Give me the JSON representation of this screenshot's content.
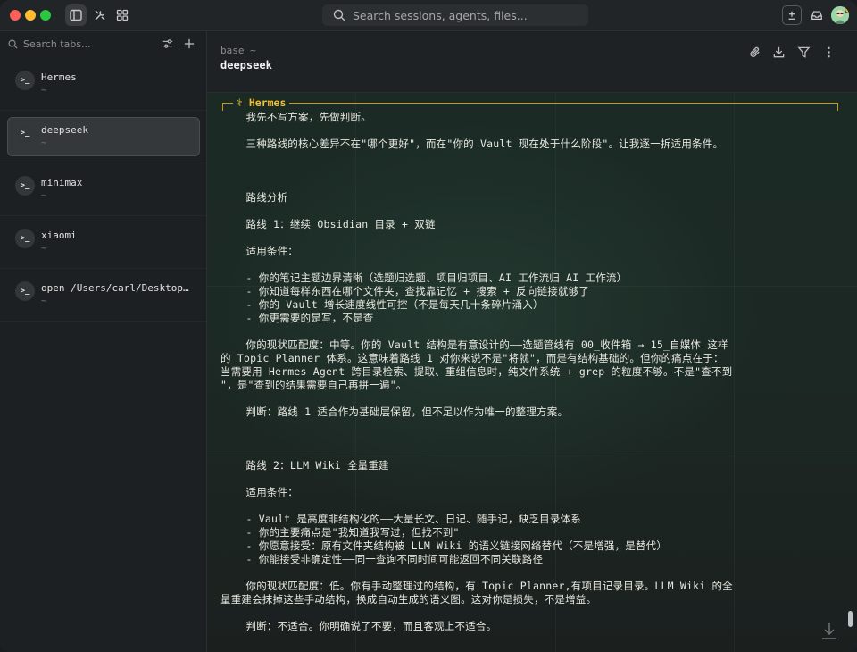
{
  "titlebar": {
    "search_placeholder": "Search sessions, agents, files..."
  },
  "sidebar": {
    "search_placeholder": "Search tabs...",
    "tabs": [
      {
        "title": "Hermes",
        "subtitle": "~",
        "selected": false
      },
      {
        "title": "deepseek",
        "subtitle": "~",
        "selected": true
      },
      {
        "title": "minimax",
        "subtitle": "~",
        "selected": false
      },
      {
        "title": "xiaomi",
        "subtitle": "~",
        "selected": false
      },
      {
        "title": "open /Users/carl/Desktop/...",
        "subtitle": "~",
        "selected": false
      }
    ],
    "tab_icon_glyph": ">_"
  },
  "main": {
    "breadcrumb": "base ~",
    "title": "deepseek"
  },
  "terminal": {
    "agent_label": "⚕ Hermes",
    "accent_color": "#f0c030",
    "lines": [
      "    我先不写方案，先做判断。",
      "",
      "    三种路线的核心差异不在\"哪个更好\"，而在\"你的 Vault 现在处于什么阶段\"。让我逐一拆适用条件。",
      "",
      "",
      "",
      "    路线分析",
      "",
      "    路线 1：继续 Obsidian 目录 + 双链",
      "",
      "    适用条件：",
      "",
      "    - 你的笔记主题边界清晰（选题归选题、项目归项目、AI 工作流归 AI 工作流）",
      "    - 你知道每样东西在哪个文件夹，查找靠记忆 + 搜索 + 反向链接就够了",
      "    - 你的 Vault 增长速度线性可控（不是每天几十条碎片涌入）",
      "    - 你更需要的是写，不是查",
      "",
      "    你的现状匹配度：中等。你的 Vault 结构是有意设计的——选题管线有 00_收件箱 → 15_自媒体 这样",
      "的 Topic Planner 体系。这意味着路线 1 对你来说不是\"将就\"，而是有结构基础的。但你的痛点在于：",
      "当需要用 Hermes Agent 跨目录检索、提取、重组信息时，纯文件系统 + grep 的粒度不够。不是\"查不到",
      "\"，是\"查到的结果需要自己再拼一遍\"。",
      "",
      "    判断：路线 1 适合作为基础层保留，但不足以作为唯一的整理方案。",
      "",
      "",
      "",
      "    路线 2：LLM Wiki 全量重建",
      "",
      "    适用条件：",
      "",
      "    - Vault 是高度非结构化的——大量长文、日记、随手记，缺乏目录体系",
      "    - 你的主要痛点是\"我知道我写过，但找不到\"",
      "    - 你愿意接受：原有文件夹结构被 LLM Wiki 的语义链接网络替代（不是增强，是替代）",
      "    - 你能接受非确定性——同一查询不同时间可能返回不同关联路径",
      "",
      "    你的现状匹配度：低。你有手动整理过的结构，有 Topic Planner,有项目记录目录。LLM Wiki 的全",
      "量重建会抹掉这些手动结构，换成自动生成的语义图。这对你是损失，不是增益。",
      "",
      "    判断：不适合。你明确说了不要，而且客观上不适合。"
    ]
  }
}
